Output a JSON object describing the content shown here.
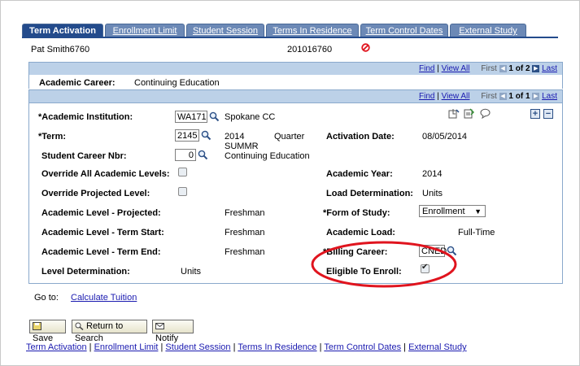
{
  "tabs": [
    {
      "label": "Term Activation"
    },
    {
      "label": "Enrollment Limit"
    },
    {
      "label": "Student Session"
    },
    {
      "label": "Terms In Residence"
    },
    {
      "label": "Term Control Dates"
    },
    {
      "label": "External Study"
    }
  ],
  "header": {
    "name": "Pat Smith6760",
    "id": "201016760"
  },
  "career_bar": {
    "find": "Find",
    "view_all": "View All",
    "first": "First",
    "count": "1 of 2",
    "last": "Last"
  },
  "career": {
    "label": "Academic Career:",
    "value": "Continuing Education"
  },
  "inst_bar": {
    "find": "Find",
    "view_all": "View All",
    "first": "First",
    "count": "1 of 1",
    "last": "Last"
  },
  "form": {
    "institution_label": "*Academic Institution:",
    "institution_value": "WA171",
    "institution_desc": "Spokane CC",
    "term_label": "*Term:",
    "term_value": "2145",
    "term_year": "2014",
    "term_type": "Quarter",
    "term_code": "SUMMR",
    "term_career": "Continuing Education",
    "activation_date_label": "Activation Date:",
    "activation_date_value": "08/05/2014",
    "career_nbr_label": "Student Career Nbr:",
    "career_nbr_value": "0",
    "override_all_label": "Override All Academic Levels:",
    "academic_year_label": "Academic Year:",
    "academic_year_value": "2014",
    "override_projected_label": "Override Projected Level:",
    "load_det_label": "Load Determination:",
    "load_det_value": "Units",
    "level_projected_label": "Academic Level - Projected:",
    "level_projected_value": "Freshman",
    "form_of_study_label": "*Form of Study:",
    "form_of_study_value": "Enrollment",
    "level_start_label": "Academic Level - Term Start:",
    "level_start_value": "Freshman",
    "academic_load_label": "Academic Load:",
    "academic_load_value": "Full-Time",
    "level_end_label": "Academic Level - Term End:",
    "level_end_value": "Freshman",
    "billing_career_label": "*Billing Career:",
    "billing_career_value": "CNED",
    "level_det_label": "Level Determination:",
    "level_det_value": "Units",
    "eligible_label": "Eligible To Enroll:"
  },
  "goto": {
    "label": "Go to:",
    "link": "Calculate Tuition"
  },
  "buttons": {
    "save": "Save",
    "return": "Return to Search",
    "notify": "Notify"
  },
  "footer_links": [
    "Term Activation",
    "Enrollment Limit",
    "Student Session",
    "Terms In Residence",
    "Term Control Dates",
    "External Study"
  ],
  "colors": {
    "tab_active": "#234b8c",
    "tab_inactive": "#6c89b6",
    "bar": "#bcd1e8",
    "annotation": "#e0141e"
  }
}
